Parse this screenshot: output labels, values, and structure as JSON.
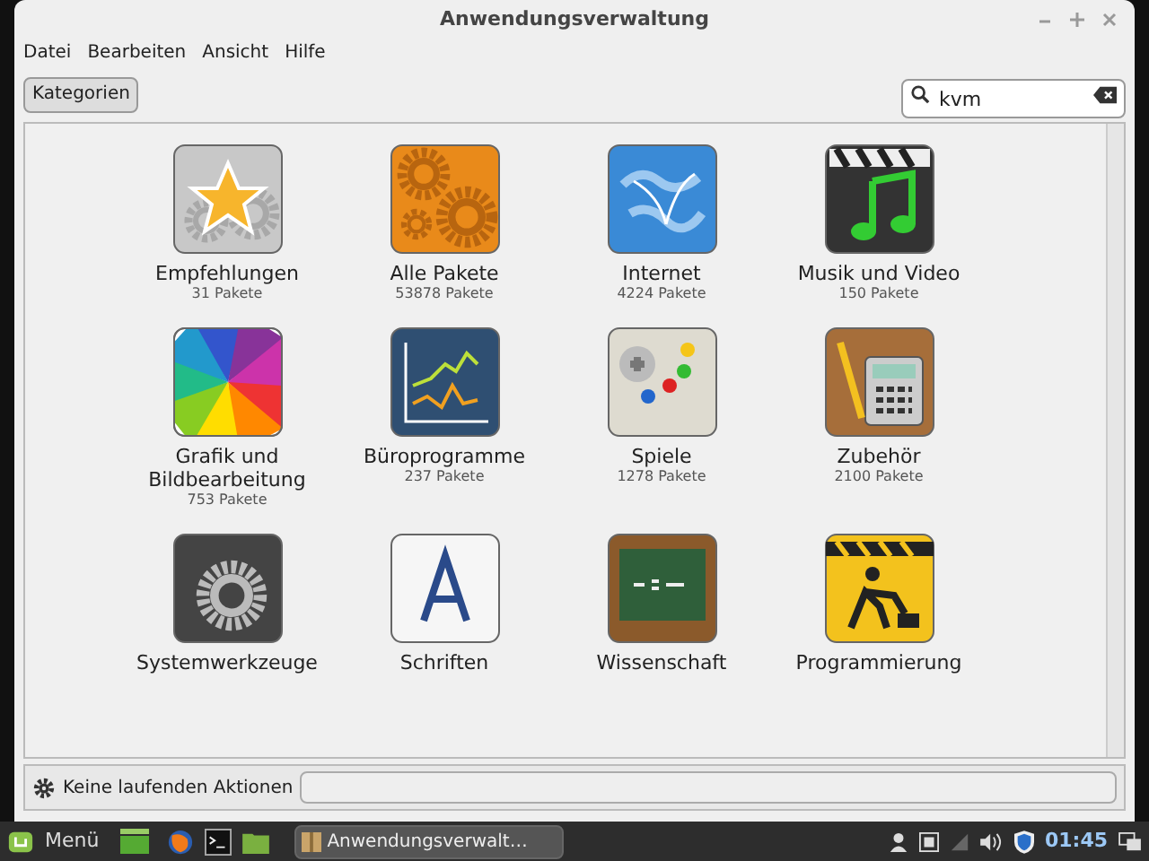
{
  "window": {
    "title": "Anwendungsverwaltung"
  },
  "menu": [
    "Datei",
    "Bearbeiten",
    "Ansicht",
    "Hilfe"
  ],
  "toolbar": {
    "button": "Kategorien"
  },
  "search": {
    "value": "kvm"
  },
  "categories": [
    {
      "name": "Empfehlungen",
      "count": "31 Pakete"
    },
    {
      "name": "Alle Pakete",
      "count": "53878 Pakete"
    },
    {
      "name": "Internet",
      "count": "4224 Pakete"
    },
    {
      "name": "Musik und Video",
      "count": "150 Pakete"
    },
    {
      "name": "Grafik und Bildbearbeitung",
      "count": "753 Pakete"
    },
    {
      "name": "Büroprogramme",
      "count": "237 Pakete"
    },
    {
      "name": "Spiele",
      "count": "1278 Pakete"
    },
    {
      "name": "Zubehör",
      "count": "2100 Pakete"
    },
    {
      "name": "Systemwerkzeuge"
    },
    {
      "name": "Schriften"
    },
    {
      "name": "Wissenschaft"
    },
    {
      "name": "Programmierung"
    }
  ],
  "status_bar": {
    "text": "Keine laufenden Aktionen",
    "level": 0
  },
  "taskbar": {
    "menu": "Menü",
    "window": "Anwendungsverwalt…",
    "clock": "01:45"
  }
}
